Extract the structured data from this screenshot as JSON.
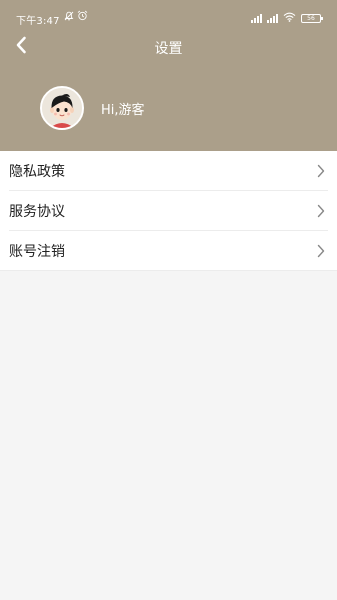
{
  "status_bar": {
    "time": "下午3:47",
    "battery": "56"
  },
  "nav": {
    "title": "设置"
  },
  "profile": {
    "greeting": "Hi,游客"
  },
  "menu": {
    "items": [
      {
        "label": "隐私政策"
      },
      {
        "label": "服务协议"
      },
      {
        "label": "账号注销"
      }
    ]
  },
  "colors": {
    "header_bg": "#ab9f8a",
    "page_bg": "#f5f5f5",
    "text_primary": "#222222",
    "chevron": "#888888"
  }
}
